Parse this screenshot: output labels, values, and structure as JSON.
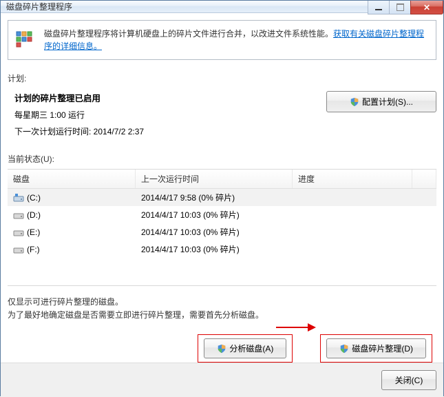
{
  "window": {
    "title": "磁盘碎片整理程序"
  },
  "info": {
    "text": "磁盘碎片整理程序将计算机硬盘上的碎片文件进行合并，以改进文件系统性能。",
    "link": "获取有关磁盘碎片整理程序的详细信息。"
  },
  "schedule": {
    "label": "计划:",
    "enabled_title": "计划的碎片整理已启用",
    "frequency": "每星期三   1:00 运行",
    "next_run": "下一次计划运行时间: 2014/7/2 2:37",
    "config_btn": "配置计划(S)..."
  },
  "status": {
    "label": "当前状态(U):",
    "headers": {
      "disk": "磁盘",
      "last": "上一次运行时间",
      "progress": "进度"
    },
    "rows": [
      {
        "name": "(C:)",
        "last": "2014/4/17 9:58 (0% 碎片)",
        "type": "system"
      },
      {
        "name": "(D:)",
        "last": "2014/4/17 10:03 (0% 碎片)",
        "type": "drive"
      },
      {
        "name": "(E:)",
        "last": "2014/4/17 10:03 (0% 碎片)",
        "type": "drive"
      },
      {
        "name": "(F:)",
        "last": "2014/4/17 10:03 (0% 碎片)",
        "type": "drive"
      }
    ]
  },
  "hint": {
    "line1": "仅显示可进行碎片整理的磁盘。",
    "line2": "为了最好地确定磁盘是否需要立即进行碎片整理，需要首先分析磁盘。"
  },
  "actions": {
    "analyze": "分析磁盘(A)",
    "defrag": "磁盘碎片整理(D)"
  },
  "footer": {
    "close": "关闭(C)"
  }
}
